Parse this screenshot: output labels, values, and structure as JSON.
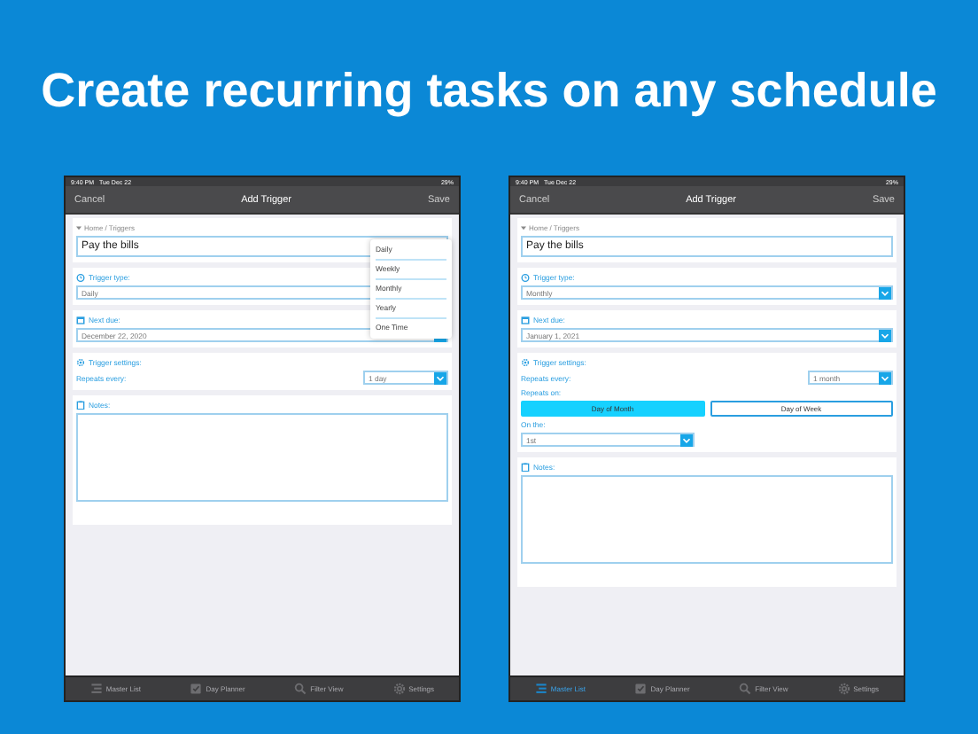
{
  "headline": "Create recurring tasks on any schedule",
  "screens": [
    {
      "status_bar": {
        "time": "9:40 PM",
        "date": "Tue Dec 22",
        "battery": "29%"
      },
      "nav": {
        "cancel": "Cancel",
        "title": "Add Trigger",
        "save": "Save"
      },
      "breadcrumb": "Home / Triggers",
      "name_field": {
        "value": "Pay the bills"
      },
      "trigger_type": {
        "label": "Trigger type:",
        "value": "Daily"
      },
      "next_due": {
        "label": "Next due:",
        "value": "December 22, 2020"
      },
      "trigger_settings": {
        "label": "Trigger settings:",
        "repeats_every_label": "Repeats every:",
        "repeats_every_value": "1 day"
      },
      "notes": {
        "label": "Notes:"
      },
      "dropdown": {
        "options": [
          "Daily",
          "Weekly",
          "Monthly",
          "Yearly",
          "One Time"
        ]
      },
      "tabs": [
        {
          "label": "Master List",
          "selected": false
        },
        {
          "label": "Day Planner",
          "selected": false
        },
        {
          "label": "Filter View",
          "selected": false
        },
        {
          "label": "Settings",
          "selected": false
        }
      ]
    },
    {
      "status_bar": {
        "time": "9:40 PM",
        "date": "Tue Dec 22",
        "battery": "29%"
      },
      "nav": {
        "cancel": "Cancel",
        "title": "Add Trigger",
        "save": "Save"
      },
      "breadcrumb": "Home / Triggers",
      "name_field": {
        "value": "Pay the bills"
      },
      "trigger_type": {
        "label": "Trigger type:",
        "value": "Monthly"
      },
      "next_due": {
        "label": "Next due:",
        "value": "January 1, 2021"
      },
      "trigger_settings": {
        "label": "Trigger settings:",
        "repeats_every_label": "Repeats every:",
        "repeats_every_value": "1 month",
        "repeats_on": {
          "label": "Repeats on:",
          "options": [
            {
              "label": "Day of Month",
              "selected": true
            },
            {
              "label": "Day of Week",
              "selected": false
            }
          ]
        },
        "on_the": {
          "label": "On the:",
          "value": "1st"
        }
      },
      "notes": {
        "label": "Notes:"
      },
      "tabs": [
        {
          "label": "Master List",
          "selected": true
        },
        {
          "label": "Day Planner",
          "selected": false
        },
        {
          "label": "Filter View",
          "selected": false
        },
        {
          "label": "Settings",
          "selected": false
        }
      ]
    }
  ]
}
